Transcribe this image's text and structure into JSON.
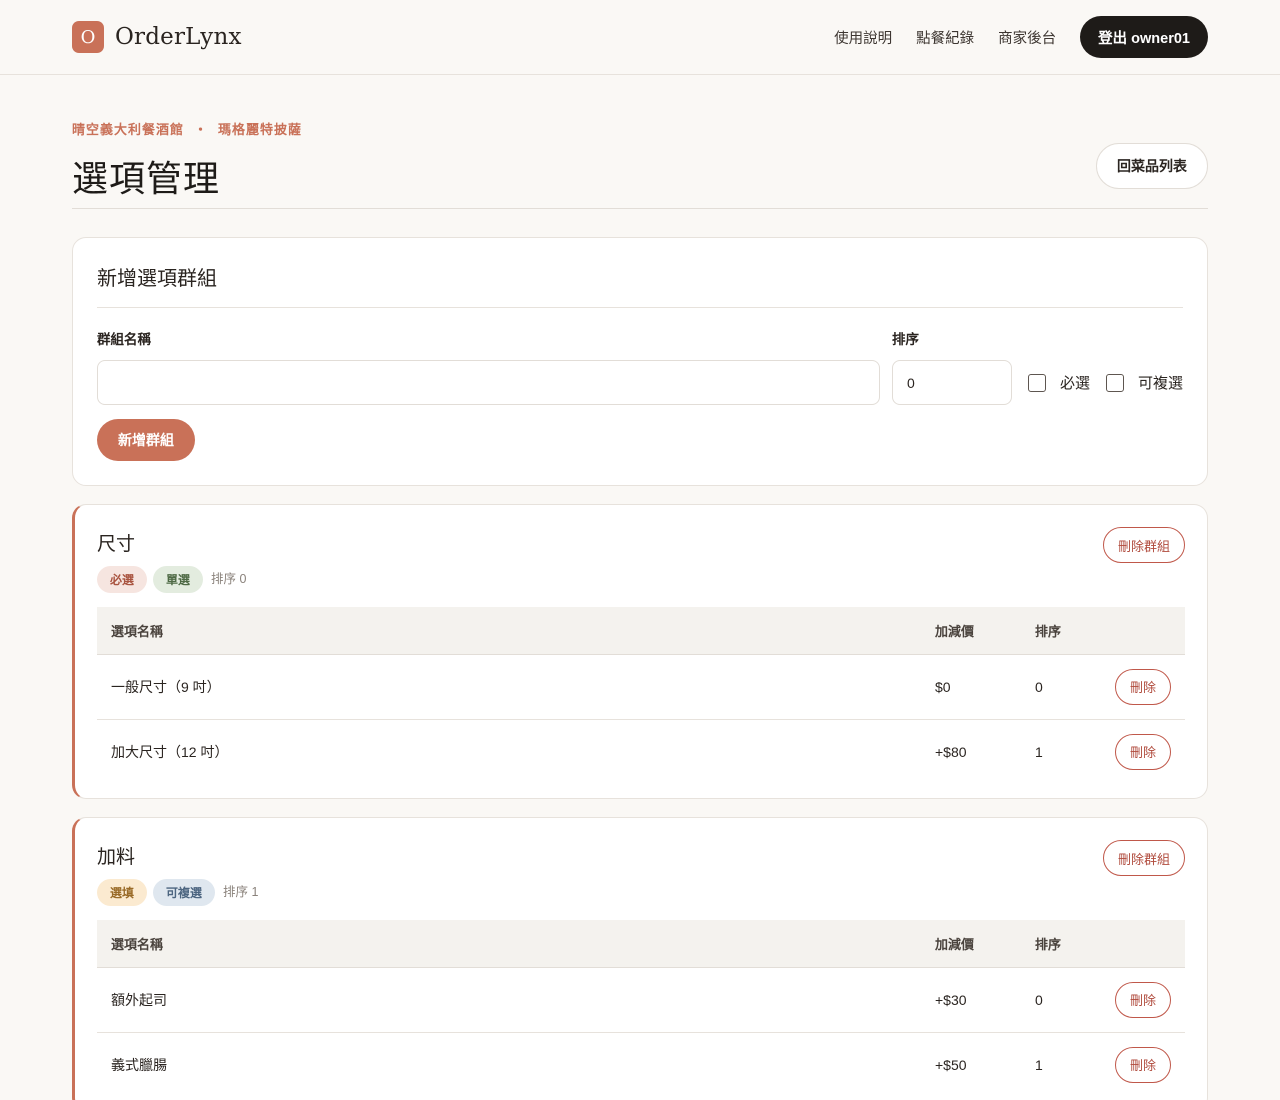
{
  "app": {
    "logo_letter": "O",
    "name": "OrderLynx"
  },
  "nav": {
    "links": [
      "使用說明",
      "點餐紀錄",
      "商家後台"
    ],
    "logout_label": "登出 owner01"
  },
  "breadcrumb": {
    "restaurant": "晴空義大利餐酒館",
    "separator": "・",
    "item": "瑪格麗特披薩"
  },
  "page_title": "選項管理",
  "back_button": "回菜品列表",
  "new_group": {
    "title": "新增選項群組",
    "name_label": "群組名稱",
    "name_value": "",
    "sort_label": "排序",
    "sort_value": "0",
    "required_label": "必選",
    "multi_label": "可複選",
    "submit_label": "新增群組"
  },
  "table_headers": {
    "name": "選項名稱",
    "price": "加減價",
    "sort": "排序"
  },
  "delete_label": "刪除",
  "delete_group_label": "刪除群組",
  "groups": [
    {
      "name": "尺寸",
      "tag1": "必選",
      "tag2": "單選",
      "sort_text": "排序 0",
      "options": [
        {
          "name": "一般尺寸（9 吋）",
          "price": "$0",
          "sort": "0"
        },
        {
          "name": "加大尺寸（12 吋）",
          "price": "+$80",
          "sort": "1"
        }
      ]
    },
    {
      "name": "加料",
      "tag1": "選填",
      "tag2": "可複選",
      "sort_text": "排序 1",
      "options": [
        {
          "name": "額外起司",
          "price": "+$30",
          "sort": "0"
        },
        {
          "name": "義式臘腸",
          "price": "+$50",
          "sort": "1"
        }
      ]
    }
  ],
  "colors": {
    "accent": "#c97158",
    "dark": "#1e1b18",
    "danger": "#b04a3c"
  }
}
